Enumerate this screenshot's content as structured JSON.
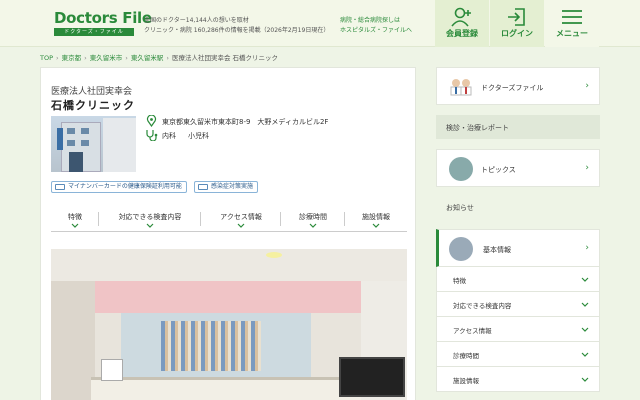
{
  "header": {
    "logo_main": "Doctors File",
    "logo_sub": "ドクターズ・ファイル",
    "tagline_line1": "全国のドクター14,144人の想いを取材",
    "tagline_line2": "クリニック・病院 160,286件の情報を掲載（2026年2月19日現在）",
    "link_line1": "病院・総合病院探しは",
    "link_line2": "ホスピタルズ・ファイルへ",
    "member_label": "会員登録",
    "login_label": "ログイン",
    "menu_label": "メニュー",
    "accent_color": "#2a8a3a"
  },
  "breadcrumb": {
    "items": [
      "TOP",
      "東京都",
      "東久留米市",
      "東久留米駅"
    ],
    "current": "医療法人社団実幸会 石橋クリニック"
  },
  "clinic": {
    "corporation": "医療法人社団実幸会",
    "name": "石橋クリニック",
    "address": "東京都東久留米市東本町8-9　大野メディカルビル2F",
    "departments": [
      "内科",
      "小児科"
    ],
    "badge_mynumber": "マイナンバーカードの健康保険証利用可能",
    "badge_infection": "感染症対策実施"
  },
  "tabs": [
    "特徴",
    "対応できる検査内容",
    "アクセス情報",
    "診療時間",
    "施設情報"
  ],
  "sidebar": {
    "doctors_file": "ドクターズファイル",
    "checkup_report": "検診・治療レポート",
    "topics": "トピックス",
    "news": "お知らせ",
    "basic_info": "基本情報",
    "sub_items": [
      "特徴",
      "対応できる検査内容",
      "アクセス情報",
      "診療時間",
      "施設情報"
    ]
  }
}
